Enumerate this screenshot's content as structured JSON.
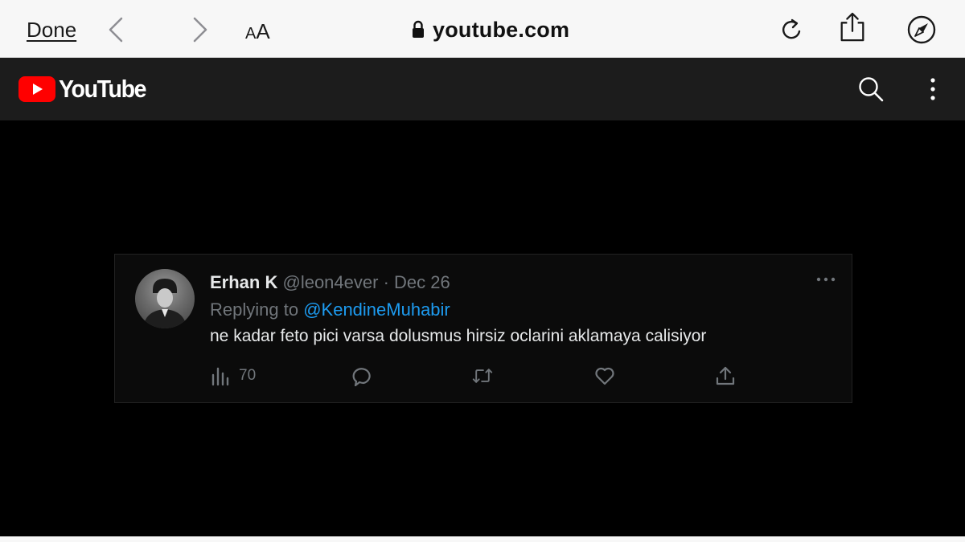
{
  "safari": {
    "done_label": "Done",
    "reader_small": "A",
    "reader_big": "A",
    "url": "youtube.com"
  },
  "youtube": {
    "logo_text": "YouTube",
    "brand_color": "#ff0000"
  },
  "tweet": {
    "author_name": "Erhan K",
    "handle": "@leon4ever",
    "separator": "·",
    "date": "Dec 26",
    "replying_prefix": "Replying to",
    "replying_to": "@KendineMuhabir",
    "text": "ne kadar feto pici varsa dolusmus hirsiz oclarini aklamaya calisiyor",
    "views": "70",
    "mention_color": "#1d9bf0"
  },
  "icons": {
    "nav_back": "chevron-left-icon",
    "nav_forward": "chevron-right-icon",
    "lock": "lock-icon",
    "reload": "reload-icon",
    "share": "share-icon",
    "compass": "compass-icon",
    "search": "search-icon",
    "more": "more-vertical-icon",
    "views": "analytics-icon",
    "reply": "reply-icon",
    "retweet": "retweet-icon",
    "like": "heart-icon",
    "tweet_share": "share-icon",
    "tweet_more": "more-horizontal-icon"
  }
}
